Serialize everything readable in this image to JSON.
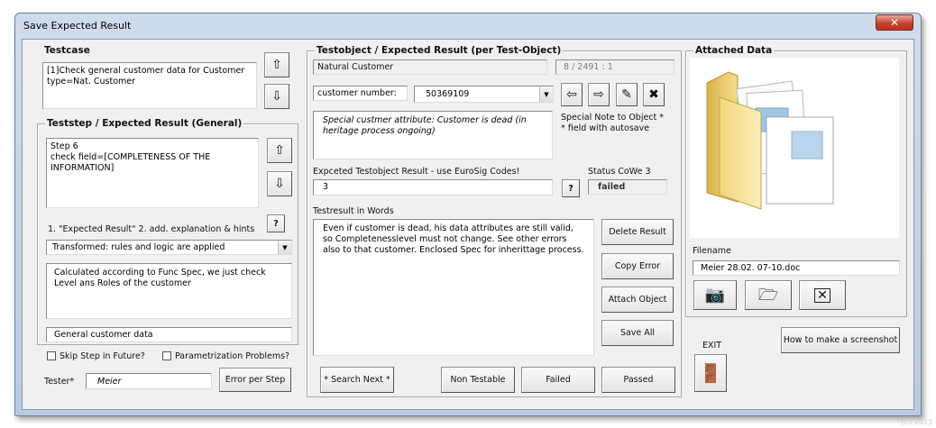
{
  "window": {
    "title": "Save Expected Result",
    "close_glyph": "✕"
  },
  "testcase": {
    "legend": "Testcase",
    "text": "[1]Check general customer data for Customer type=Nat. Customer",
    "up_icon": "arrow-up-icon",
    "down_icon": "arrow-down-icon"
  },
  "teststep": {
    "legend": "Teststep / Expected Result (General)",
    "text": "Step 6\ncheck field=[COMPLETENESS OF THE INFORMATION]",
    "hint_label": "1. \"Expected Result\"  2. add. explanation & hints",
    "help_label": "?",
    "combo_value": "Transformed: rules and logic are applied",
    "explanation": "Calculated according to Func Spec, we just check Level ans Roles of the customer",
    "category": "General customer data",
    "skip_label": "Skip Step in Future?",
    "param_label": "Parametrization Problems?",
    "tester_label": "Tester*",
    "tester_value": "Meier",
    "error_per_step": "Error per Step"
  },
  "testobject": {
    "legend": "Testobject  / Expected Result (per Test-Object)",
    "object_name": "Natural Customer",
    "counter": "8 / 2491 : 1",
    "customer_label": "customer number:",
    "customer_value": "50369109",
    "special_note": "Special custmer attribute: Customer is dead (in heritage process ongoing)",
    "special_note_label": "Special Note to Object *\n* field with autosave",
    "expected_label": "Expceted Testobject Result - use EuroSig Codes!",
    "expected_value": "3",
    "help_label": "?",
    "status_label": "Status CoWe 3",
    "status_value": "failed",
    "words_label": "Testresult in Words",
    "words_value": "Even if customer is dead, his data attributes are still valid, so Completenesslevel must not change. See other errors also to that customer. Enclosed Spec for inherittage process.",
    "nav": {
      "prev": "⇦",
      "next": "⇨",
      "edit": "✎",
      "delete": "✖"
    },
    "buttons": {
      "delete_result": "Delete Result",
      "copy_error": "Copy Error",
      "attach_object": "Attach Object",
      "save_all": "Save All",
      "search_next": "* Search Next *",
      "non_testable": "Non Testable",
      "failed": "Failed",
      "passed": "Passed"
    }
  },
  "attached": {
    "legend": "Attached Data",
    "filename_label": "Filename",
    "filename_value": "Meier 28.02. 07-10.doc",
    "how_to": "How to make a screenshot",
    "exit_label": "EXIT"
  },
  "footer": {
    "copyright": "(C) 2023"
  },
  "colors": {
    "folder": "#f2d27a",
    "close": "#c7432f",
    "frame_bg": "#f0f0f0"
  }
}
